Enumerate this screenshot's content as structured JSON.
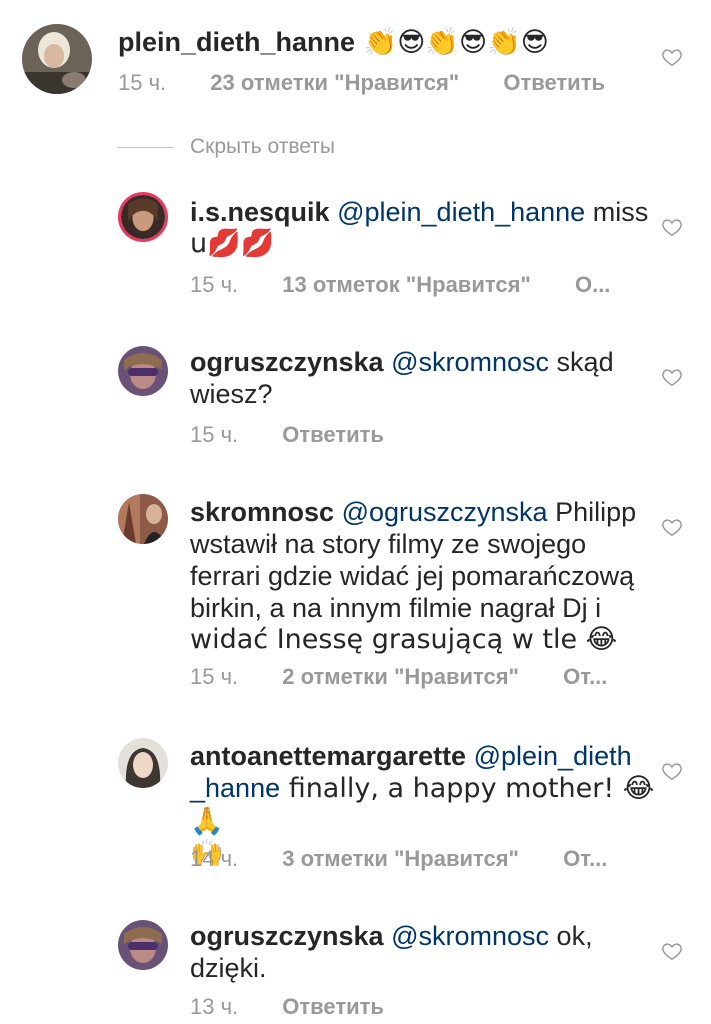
{
  "comments": [
    {
      "username": "plein_dieth_hanne",
      "mention": "",
      "text": " 👏😎👏😎👏😎",
      "time": "15 ч.",
      "likes": "23 отметки \"Нравится\"",
      "reply": "Ответить"
    },
    {
      "username": "i.s.nesquik",
      "mention": "@plein_dieth_hanne",
      "text_line1": " miss",
      "text_line2": "u💋💋",
      "time": "15 ч.",
      "likes": "13 отметок \"Нравится\"",
      "reply": "О..."
    },
    {
      "username": "ogruszczynska",
      "mention": "@skromnosc",
      "text_line1": " skąd",
      "text_line2": "wiesz?",
      "time": "15 ч.",
      "likes": "",
      "reply": "Ответить"
    },
    {
      "username": "skromnosc",
      "mention": "@ogruszczynska",
      "text_line1": " Philipp",
      "text_line2": "wstawił na story filmy ze swojego",
      "text_line3": "ferrari gdzie widać jej pomarańczową",
      "text_line4": "birkin, a na innym filmie nagrał Dj i",
      "text_line5": "widać Inessę grasującą w tle 😂",
      "time": "15 ч.",
      "likes": "2 отметки \"Нравится\"",
      "reply": "От..."
    },
    {
      "username": "antoanettemargarette",
      "mention_line1": "@plein_dieth",
      "mention_line2": "_hanne",
      "text_line2": " finally, a happy mother! 😂🙏",
      "text_line3": "🙌",
      "time": "14 ч.",
      "likes": "3 отметки \"Нравится\"",
      "reply": "От..."
    },
    {
      "username": "ogruszczynska",
      "mention": "@skromnosc",
      "text_line1": " ok,",
      "text_line2": "dzięki.",
      "time": "13 ч.",
      "likes": "",
      "reply": "Ответить"
    }
  ],
  "hide_replies": "Скрыть ответы",
  "colors": {
    "text": "#262626",
    "secondary": "#999999",
    "mention": "#003569",
    "divider": "#c7c7c7"
  }
}
